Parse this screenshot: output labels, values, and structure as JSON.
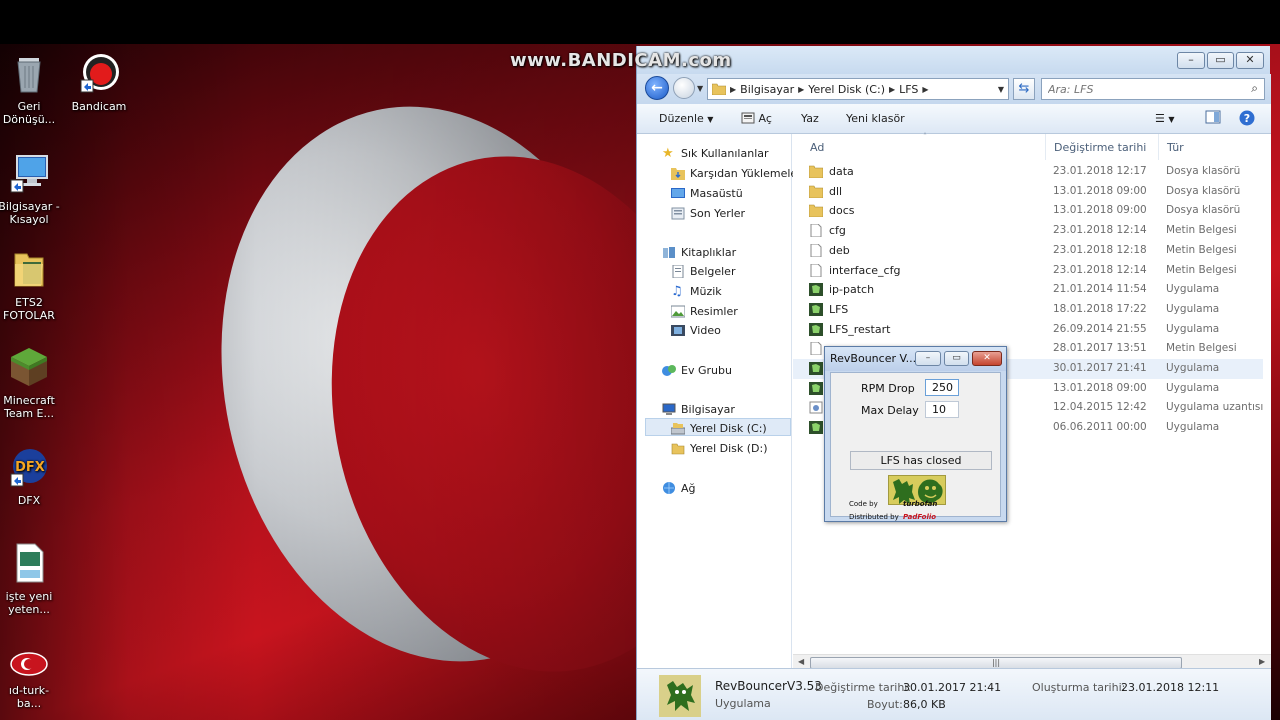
{
  "watermark": "www.BANDICAM.com",
  "desktop": {
    "icons": [
      {
        "label": "Geri Dönüşü...",
        "icon": "recycle-bin-icon"
      },
      {
        "label": "Bandicam",
        "icon": "bandicam-icon"
      },
      {
        "label": "Bilgisayar - Kısayol",
        "icon": "computer-shortcut-icon"
      },
      {
        "label": "ETS2 FOTOLAR",
        "icon": "folder-icon"
      },
      {
        "label": "Minecraft Team E...",
        "icon": "minecraft-icon"
      },
      {
        "label": "DFX",
        "icon": "dfx-icon"
      },
      {
        "label": "işte yeni yeten...",
        "icon": "avi-file-icon"
      },
      {
        "label": "ıd-turk-ba...",
        "icon": "turk-logo-icon"
      }
    ]
  },
  "explorer": {
    "breadcrumb": [
      "Bilgisayar",
      "Yerel Disk (C:)",
      "LFS"
    ],
    "search_placeholder": "Ara: LFS",
    "toolbar": {
      "organize": "Düzenle",
      "open": "Aç",
      "burn": "Yaz",
      "new_folder": "Yeni klasör"
    },
    "nav": {
      "favorites": {
        "label": "Sık Kullanılanlar",
        "items": [
          "Karşıdan Yüklemeler",
          "Masaüstü",
          "Son Yerler"
        ]
      },
      "libraries": {
        "label": "Kitaplıklar",
        "items": [
          "Belgeler",
          "Müzik",
          "Resimler",
          "Video"
        ]
      },
      "homegroup": "Ev Grubu",
      "computer": {
        "label": "Bilgisayar",
        "items": [
          "Yerel Disk (C:)",
          "Yerel Disk (D:)"
        ]
      },
      "network": "Ağ"
    },
    "columns": {
      "name": "Ad",
      "date": "Değiştirme tarihi",
      "type": "Tür"
    },
    "files": [
      {
        "name": "data",
        "date": "23.01.2018 12:17",
        "type": "Dosya klasörü",
        "kind": "folder"
      },
      {
        "name": "dll",
        "date": "13.01.2018 09:00",
        "type": "Dosya klasörü",
        "kind": "folder"
      },
      {
        "name": "docs",
        "date": "13.01.2018 09:00",
        "type": "Dosya klasörü",
        "kind": "folder"
      },
      {
        "name": "cfg",
        "date": "23.01.2018 12:14",
        "type": "Metin Belgesi",
        "kind": "doc"
      },
      {
        "name": "deb",
        "date": "23.01.2018 12:18",
        "type": "Metin Belgesi",
        "kind": "doc"
      },
      {
        "name": "interface_cfg",
        "date": "23.01.2018 12:14",
        "type": "Metin Belgesi",
        "kind": "doc"
      },
      {
        "name": "ip-patch",
        "date": "21.01.2014 11:54",
        "type": "Uygulama",
        "kind": "app"
      },
      {
        "name": "LFS",
        "date": "18.01.2018 17:22",
        "type": "Uygulama",
        "kind": "app"
      },
      {
        "name": "LFS_restart",
        "date": "26.09.2014 21:55",
        "type": "Uygulama",
        "kind": "app"
      },
      {
        "name": "",
        "date": "28.01.2017 13:51",
        "type": "Metin Belgesi",
        "kind": "doc"
      },
      {
        "name": "",
        "date": "30.01.2017 21:41",
        "type": "Uygulama",
        "kind": "app",
        "selected": true
      },
      {
        "name": "",
        "date": "13.01.2018 09:00",
        "type": "Uygulama",
        "kind": "app"
      },
      {
        "name": "",
        "date": "12.04.2015 12:42",
        "type": "Uygulama uzantısı",
        "kind": "dll"
      },
      {
        "name": "",
        "date": "06.06.2011 00:00",
        "type": "Uygulama",
        "kind": "app"
      }
    ],
    "details": {
      "name": "RevBouncerV3.53",
      "type": "Uygulama",
      "modified_label": "Değiştirme tarihi:",
      "modified_value": "30.01.2017 21:41",
      "size_label": "Boyut:",
      "size_value": "86,0 KB",
      "created_label": "Oluşturma tarihi:",
      "created_value": "23.01.2018 12:11"
    }
  },
  "dialog": {
    "title": "RevBouncer V...",
    "rpm_label": "RPM Drop",
    "rpm_value": "250",
    "delay_label": "Max Delay",
    "delay_value": "10",
    "status": "LFS has closed",
    "code_by": "Code by",
    "code_author": "turbofan",
    "dist_by": "Distributed by",
    "dist_author": "PadFolio"
  }
}
